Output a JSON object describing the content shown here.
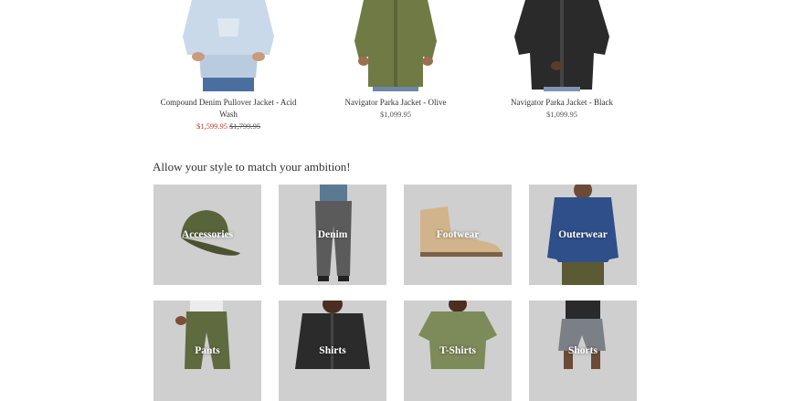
{
  "products": [
    {
      "name": "Compound Denim Pullover Jacket - Acid Wash",
      "sale_price": "$1,599.95",
      "price": "$1,799.95",
      "image_icon": "denim-pullover-jacket-photo"
    },
    {
      "name": "Navigator Parka Jacket - Olive",
      "price": "$1,099.95",
      "image_icon": "olive-parka-photo"
    },
    {
      "name": "Navigator Parka Jacket - Black",
      "price": "$1,099.95",
      "image_icon": "black-parka-photo"
    }
  ],
  "section": {
    "headline": "Allow your style to match your ambition!"
  },
  "categories": [
    {
      "label": "Accessories",
      "icon": "cap-icon"
    },
    {
      "label": "Denim",
      "icon": "jeans-icon"
    },
    {
      "label": "Footwear",
      "icon": "boot-icon"
    },
    {
      "label": "Outerwear",
      "icon": "sweater-icon"
    },
    {
      "label": "Pants",
      "icon": "pants-icon"
    },
    {
      "label": "Shirts",
      "icon": "shirt-icon"
    },
    {
      "label": "T-Shirts",
      "icon": "tshirt-icon"
    },
    {
      "label": "Shorts",
      "icon": "shorts-icon"
    }
  ],
  "colors": {
    "sale": "#c0392b",
    "tile_bg": "#cfcfcf",
    "olive": "#6f7a45",
    "black": "#2a2a2a",
    "denim": "#c8d7e6"
  }
}
